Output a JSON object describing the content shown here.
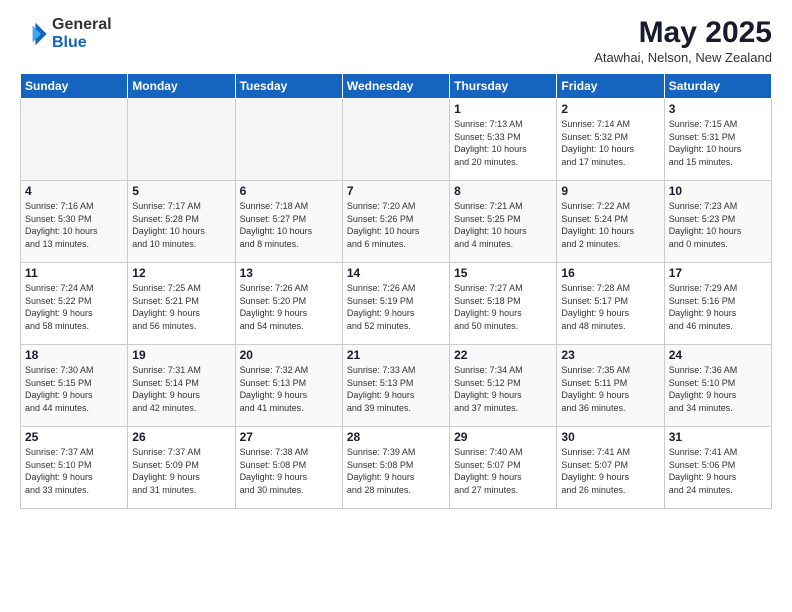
{
  "logo": {
    "general": "General",
    "blue": "Blue"
  },
  "header": {
    "month": "May 2025",
    "location": "Atawhai, Nelson, New Zealand"
  },
  "weekdays": [
    "Sunday",
    "Monday",
    "Tuesday",
    "Wednesday",
    "Thursday",
    "Friday",
    "Saturday"
  ],
  "weeks": [
    [
      {
        "day": "",
        "info": ""
      },
      {
        "day": "",
        "info": ""
      },
      {
        "day": "",
        "info": ""
      },
      {
        "day": "",
        "info": ""
      },
      {
        "day": "1",
        "info": "Sunrise: 7:13 AM\nSunset: 5:33 PM\nDaylight: 10 hours\nand 20 minutes."
      },
      {
        "day": "2",
        "info": "Sunrise: 7:14 AM\nSunset: 5:32 PM\nDaylight: 10 hours\nand 17 minutes."
      },
      {
        "day": "3",
        "info": "Sunrise: 7:15 AM\nSunset: 5:31 PM\nDaylight: 10 hours\nand 15 minutes."
      }
    ],
    [
      {
        "day": "4",
        "info": "Sunrise: 7:16 AM\nSunset: 5:30 PM\nDaylight: 10 hours\nand 13 minutes."
      },
      {
        "day": "5",
        "info": "Sunrise: 7:17 AM\nSunset: 5:28 PM\nDaylight: 10 hours\nand 10 minutes."
      },
      {
        "day": "6",
        "info": "Sunrise: 7:18 AM\nSunset: 5:27 PM\nDaylight: 10 hours\nand 8 minutes."
      },
      {
        "day": "7",
        "info": "Sunrise: 7:20 AM\nSunset: 5:26 PM\nDaylight: 10 hours\nand 6 minutes."
      },
      {
        "day": "8",
        "info": "Sunrise: 7:21 AM\nSunset: 5:25 PM\nDaylight: 10 hours\nand 4 minutes."
      },
      {
        "day": "9",
        "info": "Sunrise: 7:22 AM\nSunset: 5:24 PM\nDaylight: 10 hours\nand 2 minutes."
      },
      {
        "day": "10",
        "info": "Sunrise: 7:23 AM\nSunset: 5:23 PM\nDaylight: 10 hours\nand 0 minutes."
      }
    ],
    [
      {
        "day": "11",
        "info": "Sunrise: 7:24 AM\nSunset: 5:22 PM\nDaylight: 9 hours\nand 58 minutes."
      },
      {
        "day": "12",
        "info": "Sunrise: 7:25 AM\nSunset: 5:21 PM\nDaylight: 9 hours\nand 56 minutes."
      },
      {
        "day": "13",
        "info": "Sunrise: 7:26 AM\nSunset: 5:20 PM\nDaylight: 9 hours\nand 54 minutes."
      },
      {
        "day": "14",
        "info": "Sunrise: 7:26 AM\nSunset: 5:19 PM\nDaylight: 9 hours\nand 52 minutes."
      },
      {
        "day": "15",
        "info": "Sunrise: 7:27 AM\nSunset: 5:18 PM\nDaylight: 9 hours\nand 50 minutes."
      },
      {
        "day": "16",
        "info": "Sunrise: 7:28 AM\nSunset: 5:17 PM\nDaylight: 9 hours\nand 48 minutes."
      },
      {
        "day": "17",
        "info": "Sunrise: 7:29 AM\nSunset: 5:16 PM\nDaylight: 9 hours\nand 46 minutes."
      }
    ],
    [
      {
        "day": "18",
        "info": "Sunrise: 7:30 AM\nSunset: 5:15 PM\nDaylight: 9 hours\nand 44 minutes."
      },
      {
        "day": "19",
        "info": "Sunrise: 7:31 AM\nSunset: 5:14 PM\nDaylight: 9 hours\nand 42 minutes."
      },
      {
        "day": "20",
        "info": "Sunrise: 7:32 AM\nSunset: 5:13 PM\nDaylight: 9 hours\nand 41 minutes."
      },
      {
        "day": "21",
        "info": "Sunrise: 7:33 AM\nSunset: 5:13 PM\nDaylight: 9 hours\nand 39 minutes."
      },
      {
        "day": "22",
        "info": "Sunrise: 7:34 AM\nSunset: 5:12 PM\nDaylight: 9 hours\nand 37 minutes."
      },
      {
        "day": "23",
        "info": "Sunrise: 7:35 AM\nSunset: 5:11 PM\nDaylight: 9 hours\nand 36 minutes."
      },
      {
        "day": "24",
        "info": "Sunrise: 7:36 AM\nSunset: 5:10 PM\nDaylight: 9 hours\nand 34 minutes."
      }
    ],
    [
      {
        "day": "25",
        "info": "Sunrise: 7:37 AM\nSunset: 5:10 PM\nDaylight: 9 hours\nand 33 minutes."
      },
      {
        "day": "26",
        "info": "Sunrise: 7:37 AM\nSunset: 5:09 PM\nDaylight: 9 hours\nand 31 minutes."
      },
      {
        "day": "27",
        "info": "Sunrise: 7:38 AM\nSunset: 5:08 PM\nDaylight: 9 hours\nand 30 minutes."
      },
      {
        "day": "28",
        "info": "Sunrise: 7:39 AM\nSunset: 5:08 PM\nDaylight: 9 hours\nand 28 minutes."
      },
      {
        "day": "29",
        "info": "Sunrise: 7:40 AM\nSunset: 5:07 PM\nDaylight: 9 hours\nand 27 minutes."
      },
      {
        "day": "30",
        "info": "Sunrise: 7:41 AM\nSunset: 5:07 PM\nDaylight: 9 hours\nand 26 minutes."
      },
      {
        "day": "31",
        "info": "Sunrise: 7:41 AM\nSunset: 5:06 PM\nDaylight: 9 hours\nand 24 minutes."
      }
    ]
  ]
}
